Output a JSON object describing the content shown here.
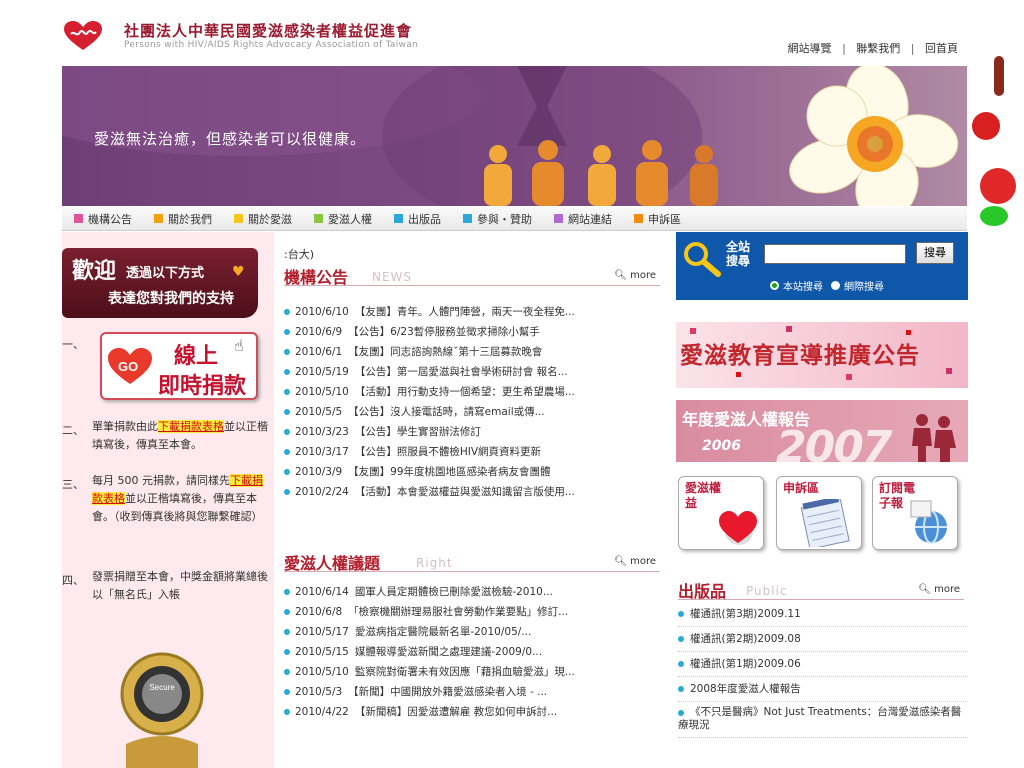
{
  "header": {
    "org_name_zh": "社團法人中華民國愛滋感染者權益促進會",
    "org_name_en": "Persons with HIV/AIDS Rights Advocacy Association of Taiwan",
    "top_links": [
      "網站導覽",
      "聯繫我們",
      "回首頁"
    ]
  },
  "banner": {
    "slogan": "愛滋無法治癒，但感染者可以很健康。"
  },
  "nav": [
    {
      "label": "機構公告",
      "color": "#e0559a"
    },
    {
      "label": "關於我們",
      "color": "#f2a20f"
    },
    {
      "label": "關於愛滋",
      "color": "#f5c518"
    },
    {
      "label": "愛滋人權",
      "color": "#8cc63f"
    },
    {
      "label": "出版品",
      "color": "#2aa8d8"
    },
    {
      "label": "參與・贊助",
      "color": "#2aa8d8"
    },
    {
      "label": "網站連結",
      "color": "#b06ad0"
    },
    {
      "label": "申訴區",
      "color": "#f28c0f"
    }
  ],
  "sidebar": {
    "welcome_big": "歡迎",
    "welcome_line1": "透過以下方式",
    "welcome_line2": "表達您對我們的支持",
    "step1_num": "一、",
    "donate_line1": "線上",
    "donate_line2": "即時捐款",
    "donate_go": "GO",
    "step2_num": "二、",
    "step2_pre": "單筆捐款由此",
    "step2_link": "下載捐款表格",
    "step2_post": "並以正楷填寫後，傳真至本會。",
    "step3_num": "三、",
    "step3_pre": "每月 500 元捐款，請同樣先",
    "step3_link": "下載捐款表格",
    "step3_post": "並以正楷填寫後，傳真至本會。（收到傳真後將與您聯繫確認）",
    "step4_num": "四、",
    "step4_text": "發票捐贈至本會，中獎金額將業總後以「無名氏」入帳",
    "seal_text": "Secure"
  },
  "center": {
    "breadcrumb": ":台大)",
    "announcements": {
      "title": "機構公告",
      "subtitle": "NEWS",
      "more": "more",
      "items": [
        {
          "date": "2010/6/10",
          "text": "【友團】青年。人體門陣營，兩天一夜全程免..."
        },
        {
          "date": "2010/6/9",
          "text": "【公告】6/23暫停服務並徵求掃除小幫手"
        },
        {
          "date": "2010/6/1",
          "text": "【友團】同志諮詢熱線ˇ第十三屆募款晚會"
        },
        {
          "date": "2010/5/19",
          "text": "【公告】第一屆愛滋與社會學術研討會 報名..."
        },
        {
          "date": "2010/5/10",
          "text": "【活動】用行動支持一個希望：更生希望農場..."
        },
        {
          "date": "2010/5/5",
          "text": "【公告】沒人接電話時，請寫email或傳..."
        },
        {
          "date": "2010/3/23",
          "text": "【公告】學生實習辦法修訂"
        },
        {
          "date": "2010/3/17",
          "text": "【公告】照服員不體檢HIV網頁資料更新"
        },
        {
          "date": "2010/3/9",
          "text": "【友團】99年度桃園地區感染者病友會團體"
        },
        {
          "date": "2010/2/24",
          "text": "【活動】本會愛滋權益與愛滋知識留言版使用..."
        }
      ]
    },
    "rights": {
      "title": "愛滋人權議題",
      "subtitle": "Right",
      "more": "more",
      "items": [
        {
          "date": "2010/6/14",
          "text": "國軍人員定期體檢已刪除愛滋檢驗-2010..."
        },
        {
          "date": "2010/6/8",
          "text": "「檢察機關辦理易服社會勞動作業要點」修訂..."
        },
        {
          "date": "2010/5/17",
          "text": "愛滋病指定醫院最新名單-2010/05/..."
        },
        {
          "date": "2010/5/15",
          "text": "媒體報導愛滋新聞之處理建議-2009/0..."
        },
        {
          "date": "2010/5/10",
          "text": "監察院對衛署未有效因應「藉捐血驗愛滋」現..."
        },
        {
          "date": "2010/5/3",
          "text": "【新聞】中國開放外籍愛滋感染者入境 - ..."
        },
        {
          "date": "2010/4/22",
          "text": "【新聞稿】因愛滋遭解雇 教您如何申訴討..."
        }
      ]
    }
  },
  "right": {
    "search_label": "全站搜尋",
    "search_value": "",
    "search_button": "搜尋",
    "radio_site": "本站搜尋",
    "radio_web": "網際搜尋",
    "promo1": "愛滋教育宣導推廣公告",
    "promo2_title": "年度愛滋人權報告",
    "promo2_year1": "2006",
    "promo2_year2": "2007",
    "icon_buttons": [
      {
        "label": "愛滋權益"
      },
      {
        "label": "申訴區"
      },
      {
        "label": "訂閱電子報"
      }
    ],
    "publications": {
      "title": "出版品",
      "subtitle": "Public",
      "more": "more",
      "items": [
        "權通訊(第3期)2009.11",
        "權通訊(第2期)2009.08",
        "權通訊(第1期)2009.06",
        "2008年度愛滋人權報告",
        "《不只是醫病》Not Just Treatments：台灣愛滋感染者醫療現況"
      ]
    }
  }
}
